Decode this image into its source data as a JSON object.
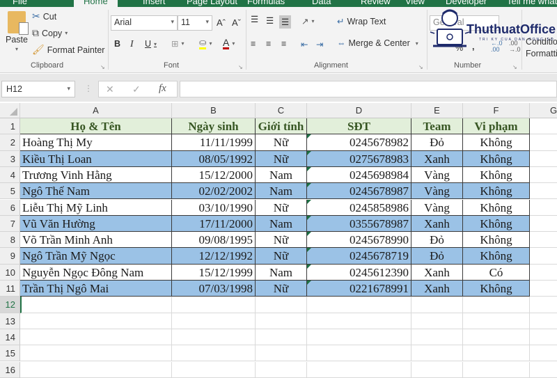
{
  "ribbon_tabs": [
    "File",
    "Home",
    "Insert",
    "Page Layout",
    "Formulas",
    "Data",
    "Review",
    "View",
    "Developer",
    "Tell me what you want to do..."
  ],
  "active_tab": "Home",
  "clipboard": {
    "paste": "Paste",
    "cut": "Cut",
    "copy": "Copy",
    "format_painter": "Format Painter",
    "label": "Clipboard"
  },
  "font": {
    "name": "Arial",
    "size": "11",
    "bold": "B",
    "italic": "I",
    "underline": "U",
    "label": "Font",
    "font_color": "#c00000"
  },
  "alignment": {
    "wrap_text": "Wrap Text",
    "merge_center": "Merge & Center",
    "label": "Alignment"
  },
  "number": {
    "format": "General",
    "percent": "%",
    "comma": ",",
    "label": "Number"
  },
  "styles": {
    "conditional_line1": "Conditio",
    "conditional_line2": "Formatti"
  },
  "watermark": {
    "brand": "ThuthuatOffice",
    "tagline": "TRI KY CUA DAN CONG SO"
  },
  "formula_bar": {
    "name_box": "H12",
    "cancel": "✕",
    "enter": "✓",
    "fx": "fx",
    "formula": ""
  },
  "columns": [
    "A",
    "B",
    "C",
    "D",
    "E",
    "F",
    "G"
  ],
  "row_numbers": [
    "1",
    "2",
    "3",
    "4",
    "5",
    "6",
    "7",
    "8",
    "9",
    "10",
    "11",
    "12",
    "13",
    "14",
    "15",
    "16"
  ],
  "selected_row": "12",
  "table": {
    "headers": [
      "Họ & Tên",
      "Ngày sinh",
      "Giới tính",
      "SĐT",
      "Team",
      "Vi phạm"
    ],
    "rows": [
      [
        "Hoàng Thị My",
        "11/11/1999",
        "Nữ",
        "0245678982",
        "Đỏ",
        "Không"
      ],
      [
        "Kiều Thị Loan",
        "08/05/1992",
        "Nữ",
        "0275678983",
        "Xanh",
        "Không"
      ],
      [
        "Trương Vinh Hằng",
        "15/12/2000",
        "Nam",
        "0245698984",
        "Vàng",
        "Không"
      ],
      [
        "Ngô Thế Nam",
        "02/02/2002",
        "Nam",
        "0245678987",
        "Vàng",
        "Không"
      ],
      [
        "Liễu Thị Mỹ Linh",
        "03/10/1990",
        "Nữ",
        "0245858986",
        "Vàng",
        "Không"
      ],
      [
        "Vũ Văn Hường",
        "17/11/2000",
        "Nam",
        "0355678987",
        "Xanh",
        "Không"
      ],
      [
        "Võ Trần Minh Anh",
        "09/08/1995",
        "Nữ",
        "0245678990",
        "Đỏ",
        "Không"
      ],
      [
        "Ngô Trần Mỹ Ngọc",
        "12/12/1992",
        "Nữ",
        "0245678719",
        "Đỏ",
        "Không"
      ],
      [
        "Nguyễn Ngọc Đông Nam",
        "15/12/1999",
        "Nam",
        "0245612390",
        "Xanh",
        "Có"
      ],
      [
        "Trần Thị Ngô Mai",
        "07/03/1998",
        "Nữ",
        "0221678991",
        "Xanh",
        "Không"
      ]
    ]
  },
  "colors": {
    "ribbon_green": "#217346",
    "header_fill": "#e2efda",
    "header_text": "#375623",
    "band_blue": "#9bc2e6"
  }
}
